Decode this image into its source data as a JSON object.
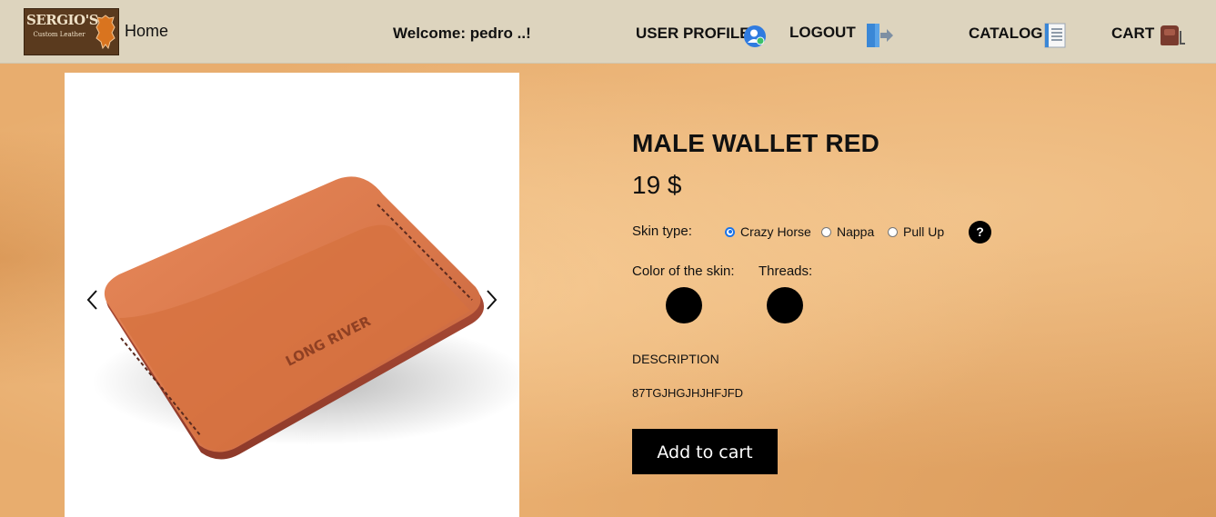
{
  "nav": {
    "logo": {
      "line1": "SERGIO'S",
      "line2": "Custom Leather"
    },
    "home": "Home",
    "welcome": "Welcome: pedro ..!",
    "user_profile": "USER PROFILE",
    "logout": "LOGOUT",
    "catalog": "CATALOG",
    "cart": "CART",
    "icons": [
      "user-profile-icon",
      "logout-icon",
      "catalog-icon",
      "cart-icon"
    ]
  },
  "product": {
    "image_imprint": "LONG RIVER",
    "title": "MALE WALLET RED",
    "price": "19 $",
    "skin_type_label": "Skin type:",
    "skin_types": [
      {
        "label": "Crazy Horse",
        "checked": true
      },
      {
        "label": "Nappa",
        "checked": false
      },
      {
        "label": "Pull Up",
        "checked": false
      }
    ],
    "help": "?",
    "skin_color_label": "Color of the skin:",
    "threads_label": "Threads:",
    "skin_color": "#000000",
    "thread_color": "#000000",
    "description_title": "DESCRIPTION",
    "description": "87TGJHGJHJHFJFD",
    "add_to_cart": "Add to cart"
  },
  "colors": {
    "navbar": "#ddd4be",
    "background": "#e8ad6e",
    "accent_radio": "#1a73e8",
    "wallet": "#d9774a"
  }
}
